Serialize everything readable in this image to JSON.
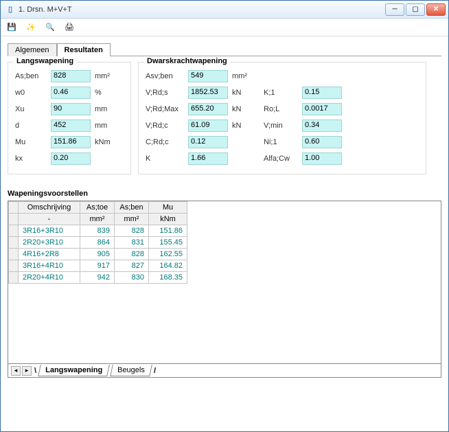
{
  "window": {
    "title": "1. Drsn. M+V+T"
  },
  "tabs": {
    "general": "Algemeen",
    "results": "Resultaten"
  },
  "groups": {
    "long": "Langswapening",
    "shear": "Dwarskrachtwapening"
  },
  "long": {
    "asben_lbl": "As;ben",
    "asben": "828",
    "asben_unit": "mm²",
    "w0_lbl": "w0",
    "w0": "0.46",
    "w0_unit": "%",
    "xu_lbl": "Xu",
    "xu": "90",
    "xu_unit": "mm",
    "d_lbl": "d",
    "d": "452",
    "d_unit": "mm",
    "mu_lbl": "Mu",
    "mu": "151.86",
    "mu_unit": "kNm",
    "kx_lbl": "kx",
    "kx": "0.20",
    "kx_unit": ""
  },
  "shear": {
    "c1": {
      "asvben_lbl": "Asv;ben",
      "asvben": "549",
      "asvben_unit": "mm²",
      "vrds_lbl": "V;Rd;s",
      "vrds": "1852.53",
      "vrds_unit": "kN",
      "vrdmax_lbl": "V;Rd;Max",
      "vrdmax": "655.20",
      "vrdmax_unit": "kN",
      "vrdc_lbl": "V;Rd;c",
      "vrdc": "61.09",
      "vrdc_unit": "kN",
      "crdc_lbl": "C;Rd;c",
      "crdc": "0.12",
      "crdc_unit": "",
      "k_lbl": "K",
      "k": "1.66",
      "k_unit": ""
    },
    "c2": {
      "k1_lbl": "K;1",
      "k1": "0.15",
      "rol_lbl": "Ro;L",
      "rol": "0.0017",
      "vmin_lbl": "V;min",
      "vmin": "0.34",
      "ni1_lbl": "Ni;1",
      "ni1": "0.60",
      "alfacw_lbl": "Alfa;Cw",
      "alfacw": "1.00"
    }
  },
  "proposals": {
    "title": "Wapeningsvoorstellen",
    "headers": {
      "desc": "Omschrijving",
      "astoe": "As;toe",
      "asben": "As;ben",
      "mu": "Mu"
    },
    "units": {
      "desc": "-",
      "astoe": "mm²",
      "asben": "mm²",
      "mu": "kNm"
    },
    "rows": [
      {
        "desc": "3R16+3R10",
        "astoe": "839",
        "asben": "828",
        "mu": "151.86"
      },
      {
        "desc": "2R20+3R10",
        "astoe": "864",
        "asben": "831",
        "mu": "155.45"
      },
      {
        "desc": "4R16+2R8",
        "astoe": "905",
        "asben": "828",
        "mu": "162.55"
      },
      {
        "desc": "3R16+4R10",
        "astoe": "917",
        "asben": "827",
        "mu": "164.82"
      },
      {
        "desc": "2R20+4R10",
        "astoe": "942",
        "asben": "830",
        "mu": "168.35"
      }
    ]
  },
  "bottom_tabs": {
    "long": "Langswapening",
    "beugels": "Beugels"
  }
}
